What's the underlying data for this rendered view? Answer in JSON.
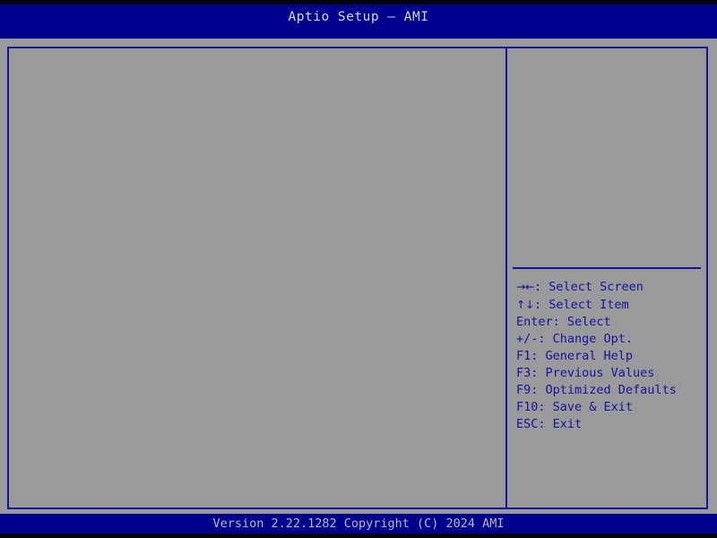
{
  "window": {
    "title": "Aptio Setup – AMI",
    "title_ghost_line": "",
    "colors": {
      "header_bg": "#00008e",
      "body_bg": "#9a9a9d",
      "border": "#141499",
      "text_blue": "#141499",
      "title_text": "#d8d8dc",
      "version_text": "#b8b8bd",
      "screen_bg": "#000000"
    }
  },
  "menu": {
    "items": []
  },
  "help": {
    "description": "",
    "keys": [
      {
        "glyph": "→←",
        "key": "",
        "label": ": Select Screen"
      },
      {
        "glyph": "↑↓",
        "key": "",
        "label": ": Select Item"
      },
      {
        "glyph": "",
        "key": "Enter",
        "label": ": Select"
      },
      {
        "glyph": "",
        "key": "+/-",
        "label": ": Change Opt."
      },
      {
        "glyph": "",
        "key": "F1",
        "label": ": General Help"
      },
      {
        "glyph": "",
        "key": "F3",
        "label": ": Previous Values"
      },
      {
        "glyph": "",
        "key": "F9",
        "label": ": Optimized Defaults"
      },
      {
        "glyph": "",
        "key": "F10",
        "label": ": Save & Exit"
      },
      {
        "glyph": "",
        "key": "ESC",
        "label": ": Exit"
      }
    ]
  },
  "footer": {
    "version": "Version 2.22.1282 Copyright (C) 2024 AMI"
  }
}
